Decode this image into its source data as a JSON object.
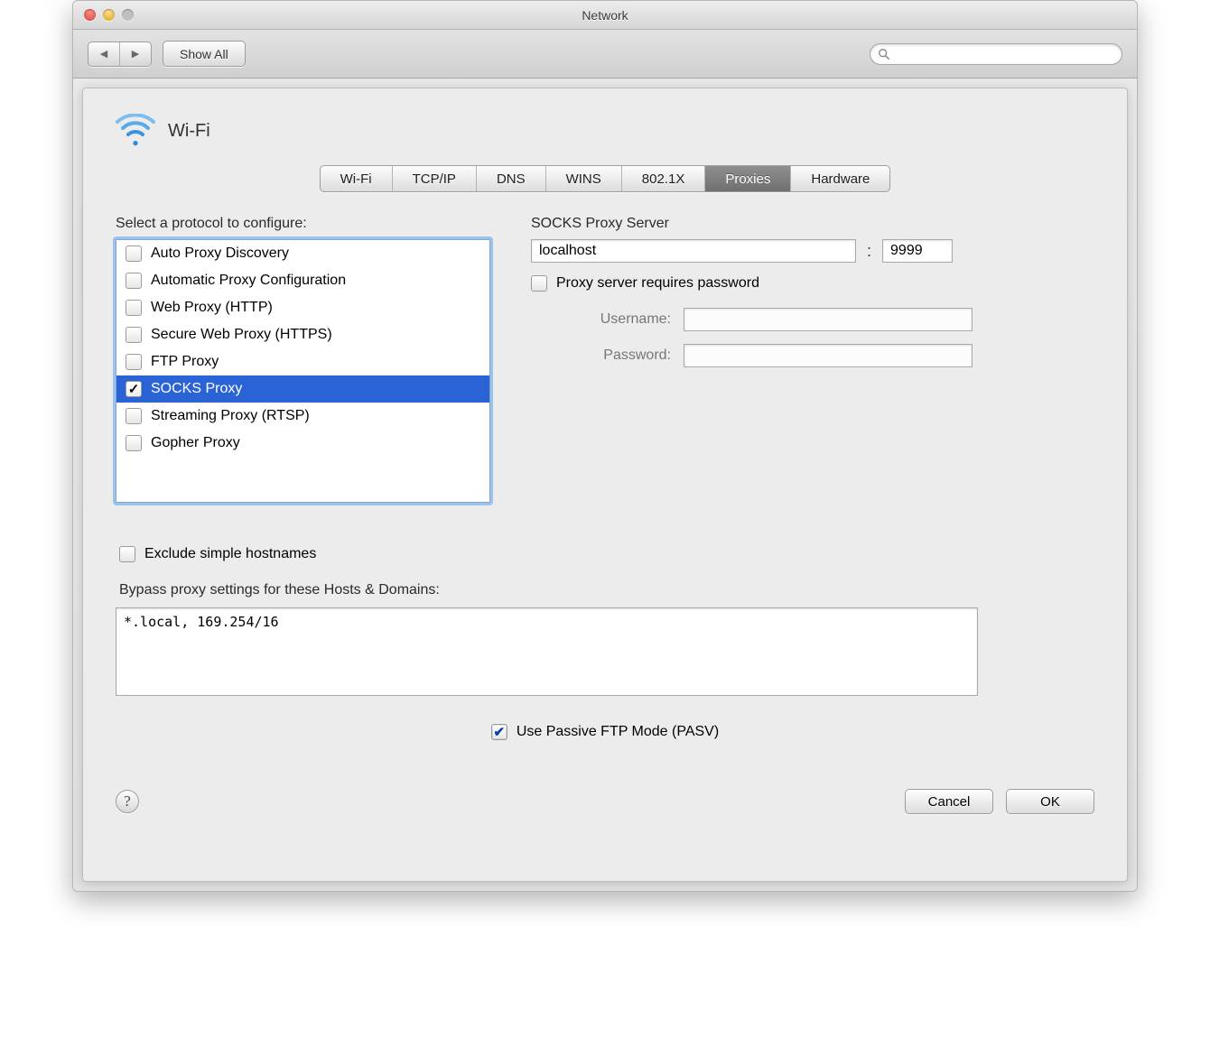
{
  "window_title": "Network",
  "toolbar": {
    "show_all": "Show All",
    "search_placeholder": ""
  },
  "header": {
    "interface": "Wi-Fi"
  },
  "tabs": [
    "Wi-Fi",
    "TCP/IP",
    "DNS",
    "WINS",
    "802.1X",
    "Proxies",
    "Hardware"
  ],
  "active_tab": "Proxies",
  "left": {
    "label": "Select a protocol to configure:",
    "protocols": [
      {
        "label": "Auto Proxy Discovery",
        "checked": false,
        "selected": false
      },
      {
        "label": "Automatic Proxy Configuration",
        "checked": false,
        "selected": false
      },
      {
        "label": "Web Proxy (HTTP)",
        "checked": false,
        "selected": false
      },
      {
        "label": "Secure Web Proxy (HTTPS)",
        "checked": false,
        "selected": false
      },
      {
        "label": "FTP Proxy",
        "checked": false,
        "selected": false
      },
      {
        "label": "SOCKS Proxy",
        "checked": true,
        "selected": true
      },
      {
        "label": "Streaming Proxy (RTSP)",
        "checked": false,
        "selected": false
      },
      {
        "label": "Gopher Proxy",
        "checked": false,
        "selected": false
      }
    ],
    "exclude_label": "Exclude simple hostnames",
    "exclude_checked": false
  },
  "right": {
    "server_label": "SOCKS Proxy Server",
    "server_host": "localhost",
    "server_port": "9999",
    "requires_password_label": "Proxy server requires password",
    "requires_password_checked": false,
    "username_label": "Username:",
    "username_value": "",
    "password_label": "Password:",
    "password_value": ""
  },
  "bypass_label": "Bypass proxy settings for these Hosts & Domains:",
  "bypass_value": "*.local, 169.254/16",
  "pasv_label": "Use Passive FTP Mode (PASV)",
  "pasv_checked": true,
  "buttons": {
    "cancel": "Cancel",
    "ok": "OK"
  }
}
